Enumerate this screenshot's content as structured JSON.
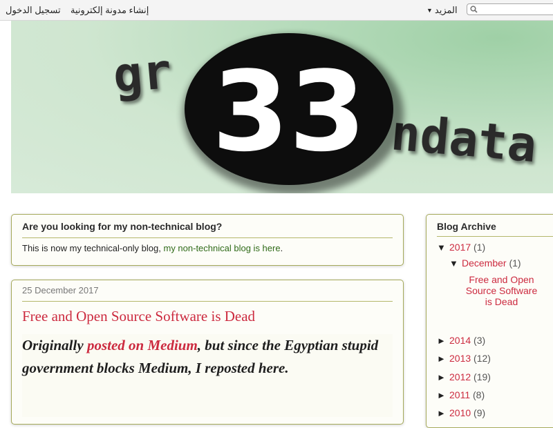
{
  "navbar": {
    "signin_label": "تسجيل الدخول",
    "create_blog_label": "إنشاء مدونة إلكترونية",
    "more_label": "المزيد",
    "search_placeholder": ""
  },
  "header": {
    "logo_text_left": "gr",
    "logo_number": "33",
    "logo_text_right": "ndata"
  },
  "notice": {
    "title": "Are you looking for my non-technical blog?",
    "text_prefix": "This is now my technical-only blog, ",
    "link_text": "my non-technical blog is here",
    "text_suffix": "."
  },
  "post": {
    "date": "25 December 2017",
    "title": "Free and Open Source Software is Dead",
    "quote_prefix": "Originally ",
    "quote_link": "posted on Medium",
    "quote_suffix": ", but since the Egyptian stupid government blocks Medium, I reposted here."
  },
  "archive": {
    "title": "Blog Archive",
    "expanded_year": {
      "toggle": "▼",
      "year": "2017",
      "count": "(1)"
    },
    "expanded_month": {
      "toggle": "▼",
      "month": "December",
      "count": "(1)"
    },
    "post_link": "Free and Open Source Software is Dead",
    "years": [
      {
        "toggle": "►",
        "year": "2014",
        "count": "(3)"
      },
      {
        "toggle": "►",
        "year": "2013",
        "count": "(12)"
      },
      {
        "toggle": "►",
        "year": "2012",
        "count": "(19)"
      },
      {
        "toggle": "►",
        "year": "2011",
        "count": "(8)"
      },
      {
        "toggle": "►",
        "year": "2010",
        "count": "(9)"
      }
    ]
  },
  "colors": {
    "accent": "#cc2a3f",
    "link_green": "#2f6a18",
    "card_border": "#a5a95a",
    "header_bg": "#cfe6d0"
  }
}
